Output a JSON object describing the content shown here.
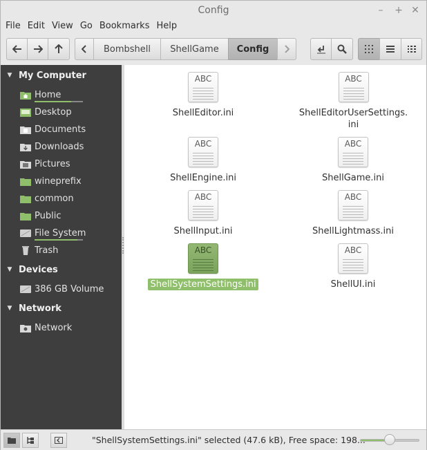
{
  "window": {
    "title": "Config",
    "minimize_glyph": "–",
    "maximize_glyph": "+",
    "close_glyph": "✕"
  },
  "menu": [
    "File",
    "Edit",
    "View",
    "Go",
    "Bookmarks",
    "Help"
  ],
  "toolbar": {
    "path": [
      "Bombshell",
      "ShellGame",
      "Config"
    ],
    "current_path": "Config"
  },
  "sidebar": {
    "sections": [
      {
        "title": "My Computer"
      },
      {
        "title": "Devices"
      },
      {
        "title": "Network"
      }
    ],
    "my_computer": [
      {
        "label": "Home",
        "icon": "home-folder-icon"
      },
      {
        "label": "Desktop",
        "icon": "desktop-icon"
      },
      {
        "label": "Documents",
        "icon": "documents-folder-icon"
      },
      {
        "label": "Downloads",
        "icon": "downloads-folder-icon"
      },
      {
        "label": "Pictures",
        "icon": "pictures-folder-icon"
      },
      {
        "label": "wineprefix",
        "icon": "folder-icon"
      },
      {
        "label": "common",
        "icon": "folder-icon"
      },
      {
        "label": "Public",
        "icon": "public-folder-icon"
      },
      {
        "label": "File System",
        "icon": "drive-icon"
      },
      {
        "label": "Trash",
        "icon": "trash-icon"
      }
    ],
    "devices": [
      {
        "label": "386 GB Volume",
        "icon": "drive-icon"
      }
    ],
    "network": [
      {
        "label": "Network",
        "icon": "network-icon"
      }
    ],
    "home_usage": 0.75,
    "filesystem_usage": 0.88
  },
  "files": [
    {
      "name": "ShellEditor.ini",
      "selected": false
    },
    {
      "name": "ShellEditorUserSettings.\nini",
      "selected": false
    },
    {
      "name": "ShellEngine.ini",
      "selected": false
    },
    {
      "name": "ShellGame.ini",
      "selected": false
    },
    {
      "name": "ShellInput.ini",
      "selected": false
    },
    {
      "name": "ShellLightmass.ini",
      "selected": false
    },
    {
      "name": "ShellSystemSettings.ini",
      "selected": true
    },
    {
      "name": "ShellUI.ini",
      "selected": false
    }
  ],
  "file_icon_text": "ABC",
  "status": {
    "text": "\"ShellSystemSettings.ini\" selected (47.6 kB), Free space: 198...",
    "zoom_level": 0.5
  },
  "colors": {
    "accent": "#8fbf6a",
    "sidebar_bg": "#3e3e3e"
  }
}
